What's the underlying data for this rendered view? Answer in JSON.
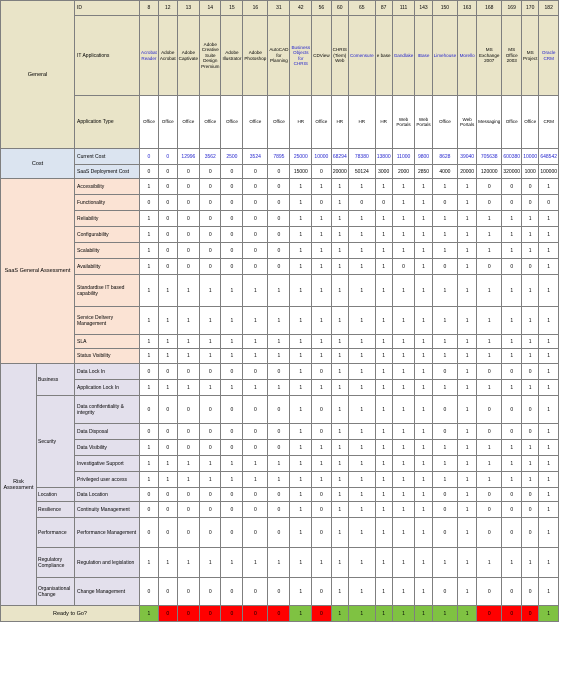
{
  "sections": {
    "general": "General",
    "cost": "Cost",
    "saas": "SaaS General Assessment",
    "risk": "Risk Assessment",
    "business": "Business",
    "security": "Security",
    "location": "Location",
    "resilience": "Resilience",
    "performance": "Performance",
    "regulatory": "Regulatory Compliance",
    "org_change": "Organisational Change"
  },
  "row_labels": {
    "id": "ID",
    "it_applications": "IT Applications",
    "application_type": "Application Type",
    "current_cost": "Current Cost",
    "saas_cost": "SaaS Deployment Cost",
    "accessibility": "Accessibility",
    "functionality": "Functionality",
    "reliability": "Reliability",
    "configurability": "Configurability",
    "scalability": "Scalability",
    "availability": "Availability",
    "standardise": "Standardise IT based capability",
    "service_delivery": "Service Delivery Management",
    "sla": "SLA",
    "status_visibility": "Status Visibility",
    "data_lock_in": "Data Lock In",
    "app_lock_in": "Application Lock In",
    "data_confidentiality": "Data confidentiality & integrity",
    "data_disposal": "Data Disposal",
    "data_visibility": "Data Visibility",
    "investigative": "Investigative Support",
    "privileged": "Privileged user access",
    "data_location": "Data Location",
    "continuity": "Continuity Management",
    "performance_mgmt": "Performance Management",
    "regulation": "Regulation and legislation",
    "change_mgmt": "Change Management",
    "ready": "Ready to Go?"
  },
  "colors": {
    "green": "#7fc242",
    "red": "#ff0000",
    "blue_text": "#1f1fcc"
  },
  "ids": [
    "8",
    "12",
    "13",
    "14",
    "15",
    "16",
    "31",
    "42",
    "56",
    "60",
    "65",
    "87",
    "111",
    "143",
    "150",
    "163",
    "168",
    "169",
    "170",
    "182"
  ],
  "apps": [
    "Acrobat Reader",
    "Adobe Acrobat",
    "Adobe Captivate",
    "Adobe Creative Suite Design Premium",
    "Adobe Illustrator",
    "Adobe Photoshop",
    "AutoCAD for Planning",
    "Business Objects for CHRIS",
    "CDView",
    "CHRIS (Tiem) Web",
    "Comensure",
    "e base",
    "Gandlake",
    "IBase",
    "Limehouse",
    "Morello",
    "MS Exchange 2007",
    "MS Office 2003",
    "MS Project",
    "Oracle CRM"
  ],
  "app_blue": [
    true,
    false,
    false,
    false,
    false,
    false,
    false,
    true,
    false,
    false,
    true,
    false,
    true,
    true,
    true,
    true,
    false,
    false,
    false,
    true
  ],
  "types": [
    "Office",
    "Office",
    "Office",
    "Office",
    "Office",
    "Office",
    "Office",
    "HR",
    "Office",
    "HR",
    "HR",
    "HR",
    "Web Portals",
    "Web Portals",
    "Office",
    "Web Portals",
    "Messaging",
    "Office",
    "Office",
    "CRM"
  ],
  "current_cost": [
    "0",
    "0",
    "12996",
    "3562",
    "2500",
    "3524",
    "7895",
    "25000",
    "10000",
    "68294",
    "78380",
    "13800",
    "11000",
    "9800",
    "8628",
    "39040",
    "705638",
    "600380",
    "10000",
    "648542"
  ],
  "current_cost_blue": [
    true,
    true,
    true,
    true,
    true,
    true,
    true,
    true,
    true,
    true,
    true,
    true,
    true,
    true,
    true,
    true,
    true,
    true,
    true,
    true
  ],
  "saas_cost": [
    "0",
    "0",
    "0",
    "0",
    "0",
    "0",
    "0",
    "15000",
    "0",
    "20000",
    "50124",
    "3000",
    "2000",
    "2850",
    "4000",
    "20000",
    "120000",
    "320000",
    "1000",
    "100000"
  ],
  "matrix": {
    "accessibility": [
      "1",
      "0",
      "0",
      "0",
      "0",
      "0",
      "0",
      "1",
      "1",
      "1",
      "1",
      "1",
      "1",
      "1",
      "1",
      "1",
      "0",
      "0",
      "0",
      "1"
    ],
    "functionality": [
      "0",
      "0",
      "0",
      "0",
      "0",
      "0",
      "0",
      "1",
      "0",
      "1",
      "0",
      "0",
      "1",
      "1",
      "0",
      "1",
      "0",
      "0",
      "0",
      "0"
    ],
    "reliability": [
      "1",
      "0",
      "0",
      "0",
      "0",
      "0",
      "0",
      "1",
      "1",
      "1",
      "1",
      "1",
      "1",
      "1",
      "1",
      "1",
      "1",
      "1",
      "1",
      "1"
    ],
    "configurability": [
      "1",
      "0",
      "0",
      "0",
      "0",
      "0",
      "0",
      "1",
      "1",
      "1",
      "1",
      "1",
      "1",
      "1",
      "1",
      "1",
      "1",
      "1",
      "1",
      "1"
    ],
    "scalability": [
      "1",
      "0",
      "0",
      "0",
      "0",
      "0",
      "0",
      "1",
      "1",
      "1",
      "1",
      "1",
      "1",
      "1",
      "1",
      "1",
      "1",
      "1",
      "1",
      "1"
    ],
    "availability": [
      "1",
      "0",
      "0",
      "0",
      "0",
      "0",
      "0",
      "1",
      "1",
      "1",
      "1",
      "1",
      "0",
      "1",
      "0",
      "1",
      "0",
      "0",
      "0",
      "1"
    ],
    "standardise": [
      "1",
      "1",
      "1",
      "1",
      "1",
      "1",
      "1",
      "1",
      "1",
      "1",
      "1",
      "1",
      "1",
      "1",
      "1",
      "1",
      "1",
      "1",
      "1",
      "1"
    ],
    "service_delivery": [
      "1",
      "1",
      "1",
      "1",
      "1",
      "1",
      "1",
      "1",
      "1",
      "1",
      "1",
      "1",
      "1",
      "1",
      "1",
      "1",
      "1",
      "1",
      "1",
      "1"
    ],
    "sla": [
      "1",
      "1",
      "1",
      "1",
      "1",
      "1",
      "1",
      "1",
      "1",
      "1",
      "1",
      "1",
      "1",
      "1",
      "1",
      "1",
      "1",
      "1",
      "1",
      "1"
    ],
    "status_visibility": [
      "1",
      "1",
      "1",
      "1",
      "1",
      "1",
      "1",
      "1",
      "1",
      "1",
      "1",
      "1",
      "1",
      "1",
      "1",
      "1",
      "1",
      "1",
      "1",
      "1"
    ],
    "data_lock_in": [
      "0",
      "0",
      "0",
      "0",
      "0",
      "0",
      "0",
      "1",
      "0",
      "1",
      "1",
      "1",
      "1",
      "1",
      "0",
      "1",
      "0",
      "0",
      "0",
      "1"
    ],
    "app_lock_in": [
      "1",
      "1",
      "1",
      "1",
      "1",
      "1",
      "1",
      "1",
      "1",
      "1",
      "1",
      "1",
      "1",
      "1",
      "1",
      "1",
      "1",
      "1",
      "1",
      "1"
    ],
    "data_confidentiality": [
      "0",
      "0",
      "0",
      "0",
      "0",
      "0",
      "0",
      "1",
      "0",
      "1",
      "1",
      "1",
      "1",
      "1",
      "0",
      "1",
      "0",
      "0",
      "0",
      "1"
    ],
    "data_disposal": [
      "0",
      "0",
      "0",
      "0",
      "0",
      "0",
      "0",
      "1",
      "0",
      "1",
      "1",
      "1",
      "1",
      "1",
      "0",
      "1",
      "0",
      "0",
      "0",
      "1"
    ],
    "data_visibility": [
      "1",
      "0",
      "0",
      "0",
      "0",
      "0",
      "0",
      "1",
      "1",
      "1",
      "1",
      "1",
      "1",
      "1",
      "1",
      "1",
      "1",
      "1",
      "1",
      "1"
    ],
    "investigative": [
      "1",
      "1",
      "1",
      "1",
      "1",
      "1",
      "1",
      "1",
      "1",
      "1",
      "1",
      "1",
      "1",
      "1",
      "1",
      "1",
      "1",
      "1",
      "1",
      "1"
    ],
    "privileged": [
      "1",
      "1",
      "1",
      "1",
      "1",
      "1",
      "1",
      "1",
      "1",
      "1",
      "1",
      "1",
      "1",
      "1",
      "1",
      "1",
      "1",
      "1",
      "1",
      "1"
    ],
    "data_location": [
      "0",
      "0",
      "0",
      "0",
      "0",
      "0",
      "0",
      "1",
      "0",
      "1",
      "1",
      "1",
      "1",
      "1",
      "0",
      "1",
      "0",
      "0",
      "0",
      "1"
    ],
    "continuity": [
      "0",
      "0",
      "0",
      "0",
      "0",
      "0",
      "0",
      "1",
      "0",
      "1",
      "1",
      "1",
      "1",
      "1",
      "0",
      "1",
      "0",
      "0",
      "0",
      "1"
    ],
    "performance_mgmt": [
      "0",
      "0",
      "0",
      "0",
      "0",
      "0",
      "0",
      "1",
      "0",
      "1",
      "1",
      "1",
      "1",
      "1",
      "0",
      "1",
      "0",
      "0",
      "0",
      "1"
    ],
    "regulation": [
      "1",
      "1",
      "1",
      "1",
      "1",
      "1",
      "1",
      "1",
      "1",
      "1",
      "1",
      "1",
      "1",
      "1",
      "1",
      "1",
      "1",
      "1",
      "1",
      "1"
    ],
    "change_mgmt": [
      "0",
      "0",
      "0",
      "0",
      "0",
      "0",
      "0",
      "1",
      "0",
      "1",
      "1",
      "1",
      "1",
      "1",
      "0",
      "1",
      "0",
      "0",
      "0",
      "1"
    ]
  },
  "ready": [
    "1",
    "0",
    "0",
    "0",
    "0",
    "0",
    "0",
    "1",
    "0",
    "1",
    "1",
    "1",
    "1",
    "1",
    "1",
    "1",
    "0",
    "0",
    "0",
    "1"
  ]
}
